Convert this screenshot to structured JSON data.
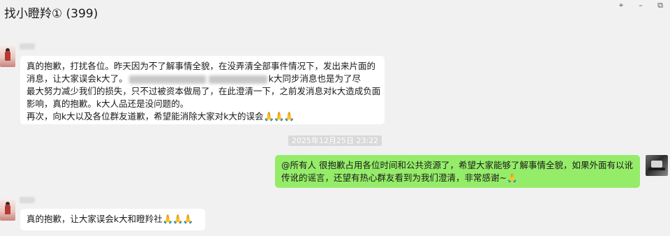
{
  "window": {
    "title": "找小瞪羚① (399)",
    "controls": [
      {
        "name": "pin-icon",
        "glyph": "⌖"
      },
      {
        "name": "minimize-icon",
        "glyph": "–"
      },
      {
        "name": "restore-icon",
        "glyph": "⧉"
      }
    ]
  },
  "messages": [
    {
      "side": "left",
      "lines": [
        "真的抱歉，打扰各位。昨天因为不了解事情全貌，在没弄清全部事件情况下，发出来片面的",
        "消息，让大家误会k大了。",
        "k大同步消息也是为了尽",
        "最大努力减少我们的损失，只不过被资本做局了，在此澄清一下，之前发消息对k大造成负面",
        "影响，真的抱歉。k大人品还是没问题的。",
        "再次，向k大以及各位群友道歉，希望能消除大家对k大的误会"
      ],
      "emoji": "🙏🙏🙏"
    },
    {
      "timestamp": "2025年12月25日 23:22"
    },
    {
      "side": "right",
      "lines": [
        "@所有人  很抱歉占用各位时间和公共资源了，希望大家能够了解事情全貌，如果外面有以讹",
        "传讹的谣言，还望有热心群友看到为我们澄清，非常感谢~"
      ],
      "emoji": "🙏"
    },
    {
      "side": "left",
      "lines": [
        "真的抱歉，让大家误会k大和瞪羚社"
      ],
      "emoji": "🙏🙏🙏"
    }
  ],
  "colors": {
    "background": "#f1f1f1",
    "bubble_left": "#ffffff",
    "bubble_right": "#95ec69",
    "timestamp_bg": "#d9d9d9"
  }
}
